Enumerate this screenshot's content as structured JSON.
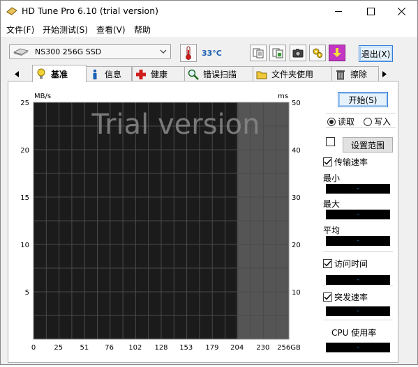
{
  "window": {
    "title": "HD Tune Pro 6.10 (trial version)",
    "controls": {
      "minimize": "—",
      "maximize": "☐",
      "close": "✕"
    }
  },
  "menu": [
    {
      "label": "文件(F)"
    },
    {
      "label": "开始测试(S)"
    },
    {
      "label": "查看(V)"
    },
    {
      "label": "帮助"
    }
  ],
  "toolbar": {
    "drive": "NS300 256G SSD",
    "temperature": "33°C",
    "exit_label": "退出(X)"
  },
  "tabs": [
    {
      "label": "基准",
      "icon": "benchmark-icon",
      "active": true
    },
    {
      "label": "信息",
      "icon": "info-icon",
      "active": false
    },
    {
      "label": "健康",
      "icon": "health-icon",
      "active": false
    },
    {
      "label": "错误扫描",
      "icon": "error-scan-icon",
      "active": false
    },
    {
      "label": "文件夹使用",
      "icon": "folder-usage-icon",
      "active": false
    },
    {
      "label": "擦除",
      "icon": "erase-icon",
      "active": false
    }
  ],
  "side": {
    "start_label": "开始(S)",
    "read_label": "读取",
    "write_label": "写入",
    "read_selected": true,
    "range_label": "设置范围",
    "range_checked": false,
    "transfer_rate_label": "传输速率",
    "transfer_rate_checked": true,
    "min_label": "最小",
    "min_value": "-",
    "max_label": "最大",
    "max_value": "-",
    "avg_label": "平均",
    "avg_value": "-",
    "access_time_label": "访问时间",
    "access_time_checked": true,
    "access_time_value": "-",
    "burst_rate_label": "突发速率",
    "burst_rate_checked": true,
    "burst_rate_value": "-",
    "cpu_label": "CPU 使用率",
    "cpu_value": "-"
  },
  "chart_data": {
    "type": "line",
    "watermark": "Trial version",
    "left_unit": "MB/s",
    "right_unit": "ms",
    "y_left_ticks": [
      "25",
      "20",
      "15",
      "10",
      "5"
    ],
    "y_left_range": [
      0,
      25
    ],
    "y_right_ticks": [
      "50",
      "40",
      "30",
      "20",
      "10"
    ],
    "y_right_range": [
      0,
      50
    ],
    "x_ticks": [
      "0",
      "25",
      "51",
      "76",
      "102",
      "128",
      "153",
      "179",
      "204",
      "230",
      "256gb"
    ],
    "x_range": [
      0,
      256
    ],
    "x_unit": "GB",
    "grid": true,
    "series": [],
    "trial_locked_from": 204,
    "colors": {
      "plot_bg": "#1b1b1b",
      "locked_bg": "#555555",
      "grid": "#4a4a4a"
    }
  }
}
